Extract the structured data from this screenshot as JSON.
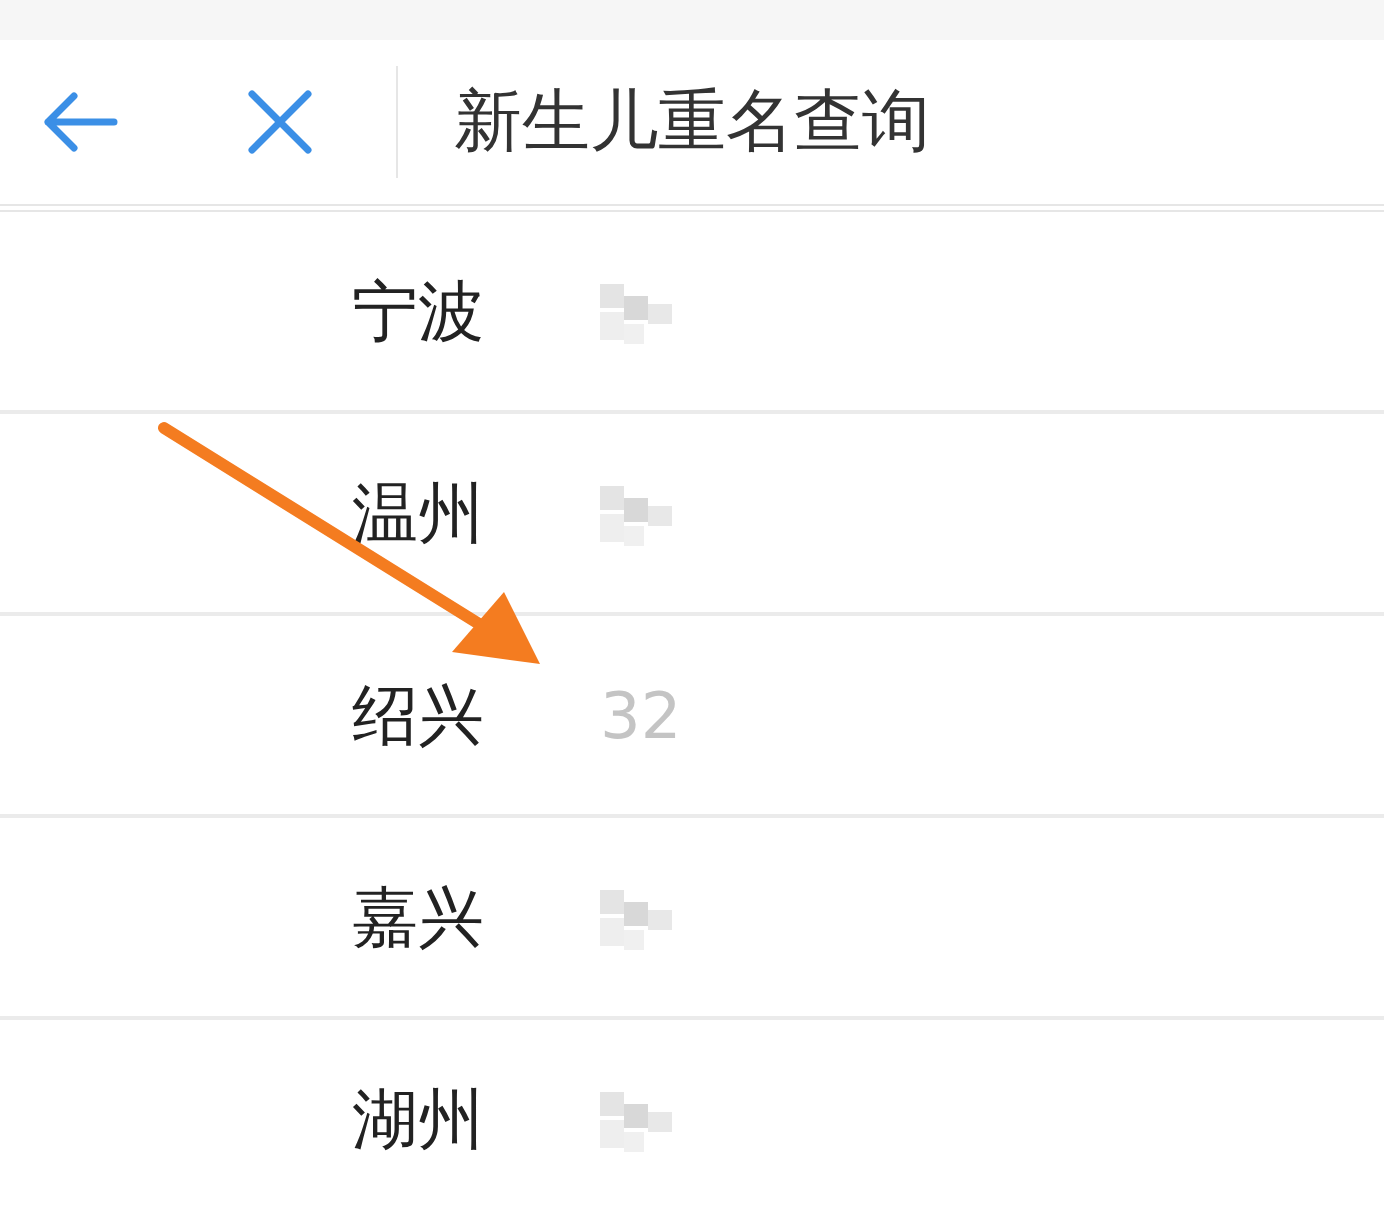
{
  "header": {
    "title": "新生儿重名查询"
  },
  "rows": [
    {
      "city": "宁波",
      "kind": "redacted"
    },
    {
      "city": "温州",
      "kind": "redacted"
    },
    {
      "city": "绍兴",
      "kind": "value",
      "value": "32"
    },
    {
      "city": "嘉兴",
      "kind": "redacted"
    },
    {
      "city": "湖州",
      "kind": "redacted"
    }
  ]
}
